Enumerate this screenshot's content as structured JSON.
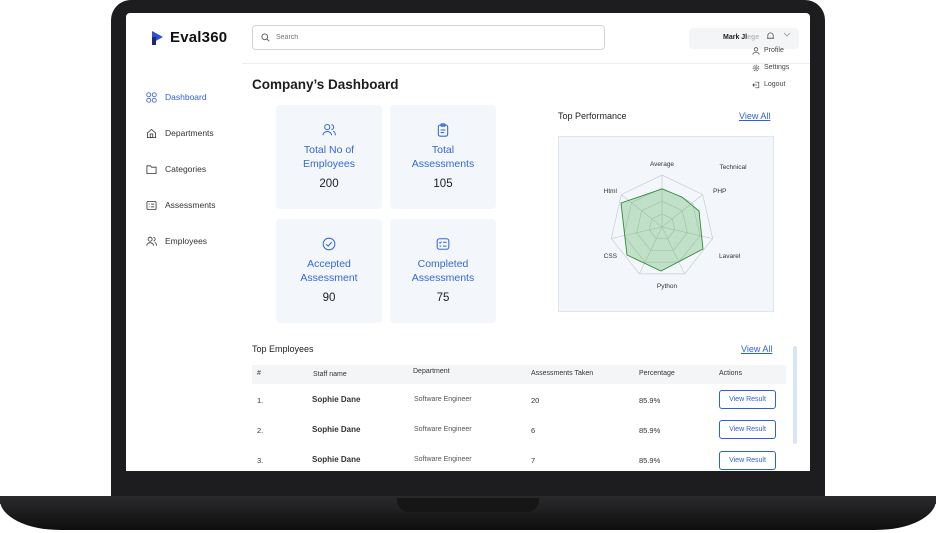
{
  "app": {
    "logo_text": "Eval360",
    "brand_color": "#2f4fd8",
    "accent_color": "#3566d8"
  },
  "header": {
    "search_placeholder": "Search",
    "user_name": "Mark Jl",
    "user_name_faded": "ege",
    "menu": [
      {
        "label": "Profile",
        "icon": "user-icon"
      },
      {
        "label": "Settings",
        "icon": "gear-icon"
      },
      {
        "label": "Logout",
        "icon": "logout-icon"
      }
    ]
  },
  "sidebar": {
    "items": [
      {
        "label": "Dashboard",
        "icon": "grid-icon",
        "active": true
      },
      {
        "label": "Departments",
        "icon": "home-icon",
        "active": false
      },
      {
        "label": "Categories",
        "icon": "folder-icon",
        "active": false
      },
      {
        "label": "Assessments",
        "icon": "list-icon",
        "active": false
      },
      {
        "label": "Employees",
        "icon": "users-icon",
        "active": false
      }
    ]
  },
  "main": {
    "title": "Company’s Dashboard",
    "cards": [
      {
        "label_line1": "Total No of",
        "label_line2": "Employees",
        "value": "200",
        "icon": "users-icon"
      },
      {
        "label_line1": "Total",
        "label_line2": "Assessments",
        "value": "105",
        "icon": "clipboard-icon"
      },
      {
        "label_line1": "Accepted",
        "label_line2": "Assessment",
        "value": "90",
        "icon": "check-circle-icon"
      },
      {
        "label_line1": "Completed",
        "label_line2": "Assessments",
        "value": "75",
        "icon": "checklist-icon"
      }
    ],
    "top_performance": {
      "title": "Top Performance",
      "link": "View All",
      "labels": [
        "Average",
        "Technical",
        "PHP",
        "Lavarel",
        "Python",
        "CSS",
        "Html"
      ],
      "series_color": "#4caf50"
    },
    "top_employees": {
      "title": "Top Employees",
      "link": "View All",
      "columns": [
        "#",
        "Staff name",
        "Department",
        "Assessments Taken",
        "Percentage",
        "Actions"
      ],
      "rows": [
        {
          "num": "1.",
          "name": "Sophie Dane",
          "dept": "Software Engineer",
          "taken": "20",
          "pct": "85.9%",
          "action": "View Result"
        },
        {
          "num": "2.",
          "name": "Sophie Dane",
          "dept": "Software Engineer",
          "taken": "6",
          "pct": "85.9%",
          "action": "View Result"
        },
        {
          "num": "3.",
          "name": "Sophie Dane",
          "dept": "Software Engineer",
          "taken": "7",
          "pct": "85.9%",
          "action": "View Result"
        }
      ]
    }
  }
}
